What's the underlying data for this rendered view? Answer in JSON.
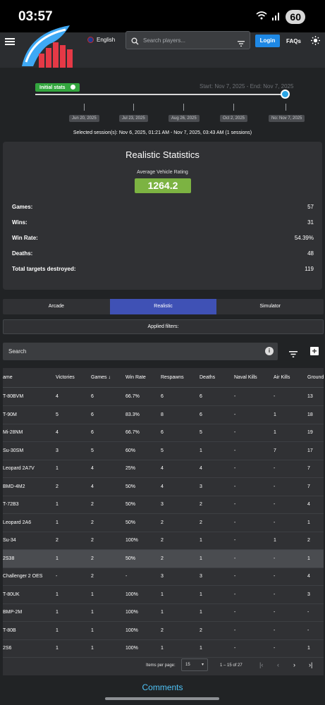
{
  "status_bar": {
    "time": "03:57",
    "battery": "60"
  },
  "header": {
    "language": "English",
    "search_placeholder": "Search players...",
    "login_label": "Login",
    "faqs_label": "FAQs"
  },
  "timeline": {
    "initial_label": "Initial stats",
    "range_text": "Start: Nov 7, 2025 - End: Nov 7, 2025",
    "ticks": [
      "Jun 20, 2025",
      "Jul 23, 2025",
      "Aug 26, 2025",
      "Oct 2, 2025",
      "No: Nov 7, 2025"
    ],
    "session_text": "Selected session(s): Nov 6, 2025, 01:21 AM - Nov 7, 2025, 03:43 AM (1 sessions)"
  },
  "stats": {
    "title": "Realistic Statistics",
    "avg_label": "Average Vehicle Rating",
    "avg_value": "1264.2",
    "rows": [
      {
        "label": "Games:",
        "value": "57"
      },
      {
        "label": "Wins:",
        "value": "31"
      },
      {
        "label": "Win Rate:",
        "value": "54.39%"
      },
      {
        "label": "Deaths:",
        "value": "48"
      },
      {
        "label": "Total targets destroyed:",
        "value": "119"
      }
    ]
  },
  "tabs": [
    "Arcade",
    "Realistic",
    "Simulator"
  ],
  "active_tab": "Realistic",
  "filters_label": "Applied filters:",
  "table_search_label": "Search",
  "table": {
    "headers": [
      "ame",
      "Victories",
      "Games ↓",
      "Win Rate",
      "Respawns",
      "Deaths",
      "Naval Kills",
      "Air Kills",
      "Ground"
    ],
    "rows": [
      [
        "T-80BVM",
        "4",
        "6",
        "66.7%",
        "6",
        "6",
        "-",
        "-",
        "13"
      ],
      [
        "T-90M",
        "5",
        "6",
        "83.3%",
        "8",
        "6",
        "-",
        "1",
        "18"
      ],
      [
        "Mi-28NM",
        "4",
        "6",
        "66.7%",
        "6",
        "5",
        "-",
        "1",
        "19"
      ],
      [
        "Su-30SM",
        "3",
        "5",
        "60%",
        "5",
        "1",
        "-",
        "7",
        "17"
      ],
      [
        "Leopard 2A7V",
        "1",
        "4",
        "25%",
        "4",
        "4",
        "-",
        "-",
        "7"
      ],
      [
        "BMD-4M2",
        "2",
        "4",
        "50%",
        "4",
        "3",
        "-",
        "-",
        "7"
      ],
      [
        "T-72B3",
        "1",
        "2",
        "50%",
        "3",
        "2",
        "-",
        "-",
        "4"
      ],
      [
        "Leopard 2A6",
        "1",
        "2",
        "50%",
        "2",
        "2",
        "-",
        "-",
        "1"
      ],
      [
        "Su-34",
        "2",
        "2",
        "100%",
        "2",
        "1",
        "-",
        "1",
        "2"
      ],
      [
        "2S38",
        "1",
        "2",
        "50%",
        "2",
        "1",
        "-",
        "-",
        "1"
      ],
      [
        "Challenger 2 OES",
        "-",
        "2",
        "-",
        "3",
        "3",
        "-",
        "-",
        "4"
      ],
      [
        "T-80UK",
        "1",
        "1",
        "100%",
        "1",
        "1",
        "-",
        "-",
        "3"
      ],
      [
        "BMP-2M",
        "1",
        "1",
        "100%",
        "1",
        "1",
        "-",
        "-",
        "-"
      ],
      [
        "T-80B",
        "1",
        "1",
        "100%",
        "2",
        "2",
        "-",
        "-",
        "-"
      ],
      [
        "2S6",
        "1",
        "1",
        "100%",
        "1",
        "1",
        "-",
        "-",
        "1"
      ]
    ],
    "selected_row": "2S38",
    "items_per_page_label": "Items per page:",
    "items_per_page": "15",
    "range_label": "1 – 15 of 27"
  },
  "comments_label": "Comments",
  "colors": {
    "accent": "#3f51b5",
    "rating": "#7cb342",
    "login": "#1e88e5",
    "initial": "#33a63e",
    "link": "#4fc3f7"
  }
}
